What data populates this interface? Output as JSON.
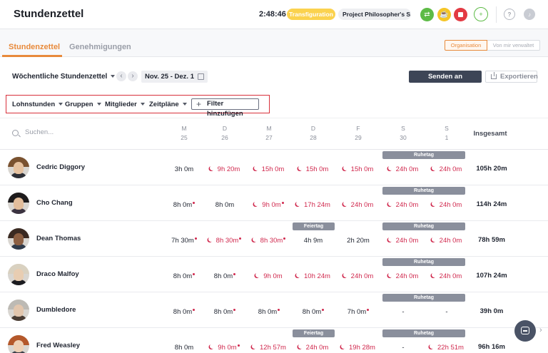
{
  "header": {
    "title": "Stundenzettel",
    "timer": "2:48:46",
    "activity": "Transfiguration",
    "project": "Project Philosopher's S...",
    "icons": [
      "switch-activity-icon",
      "break-icon",
      "stop-icon",
      "add-time-icon",
      "help-icon",
      "notifications-icon"
    ],
    "help_glyph": "?"
  },
  "tabs": [
    {
      "label": "Stundenzettel",
      "active": true
    },
    {
      "label": "Genehmigungen",
      "active": false
    }
  ],
  "scope_toggle": {
    "organisation": "Organisation",
    "managed": "Von mir verwaltet",
    "selected": "Organisation"
  },
  "toolbar": {
    "view_select": "Wöchentliche Stundenzettel",
    "date_range": "Nov. 25 - Dez. 1",
    "qb_button": "Senden an QuickBooks",
    "export_button": "Exportieren"
  },
  "filters": {
    "items": [
      "Lohnstunden",
      "Gruppen",
      "Mitglieder",
      "Zeitpläne"
    ],
    "add_filter": "Filter hinzufügen"
  },
  "search": {
    "placeholder": "Suchen..."
  },
  "columns": {
    "days": [
      {
        "letter": "M",
        "date": "25"
      },
      {
        "letter": "D",
        "date": "26"
      },
      {
        "letter": "M",
        "date": "27"
      },
      {
        "letter": "D",
        "date": "28"
      },
      {
        "letter": "F",
        "date": "29"
      },
      {
        "letter": "S",
        "date": "30"
      },
      {
        "letter": "S",
        "date": "1"
      }
    ],
    "total": "Insgesamt"
  },
  "badges": {
    "rest": "Ruhetag",
    "holiday": "Feiertag"
  },
  "colors": {
    "accent": "#e88a3b",
    "overtime": "#d0284d",
    "primary_button": "#3d4556",
    "highlight_box": "#d8303b"
  },
  "rows": [
    {
      "name": "Cedric Diggory",
      "total": "105h 20m",
      "holiday": false,
      "cells": [
        {
          "v": "3h 0m",
          "ot": false,
          "dot": false
        },
        {
          "v": "9h 20m",
          "ot": true,
          "dot": false
        },
        {
          "v": "15h 0m",
          "ot": true,
          "dot": false
        },
        {
          "v": "15h 0m",
          "ot": true,
          "dot": false
        },
        {
          "v": "15h 0m",
          "ot": true,
          "dot": false
        },
        {
          "v": "24h 0m",
          "ot": true,
          "dot": false
        },
        {
          "v": "24h 0m",
          "ot": true,
          "dot": false
        }
      ]
    },
    {
      "name": "Cho Chang",
      "total": "114h 24m",
      "holiday": false,
      "cells": [
        {
          "v": "8h 0m",
          "ot": false,
          "dot": true
        },
        {
          "v": "8h 0m",
          "ot": false,
          "dot": false
        },
        {
          "v": "9h 0m",
          "ot": true,
          "dot": true
        },
        {
          "v": "17h 24m",
          "ot": true,
          "dot": false
        },
        {
          "v": "24h 0m",
          "ot": true,
          "dot": false
        },
        {
          "v": "24h 0m",
          "ot": true,
          "dot": false
        },
        {
          "v": "24h 0m",
          "ot": true,
          "dot": false
        }
      ]
    },
    {
      "name": "Dean Thomas",
      "total": "78h 59m",
      "holiday": true,
      "cells": [
        {
          "v": "7h 30m",
          "ot": false,
          "dot": true
        },
        {
          "v": "8h 30m",
          "ot": true,
          "dot": true
        },
        {
          "v": "8h 30m",
          "ot": true,
          "dot": true
        },
        {
          "v": "4h 9m",
          "ot": false,
          "dot": false
        },
        {
          "v": "2h 20m",
          "ot": false,
          "dot": false
        },
        {
          "v": "24h 0m",
          "ot": true,
          "dot": false
        },
        {
          "v": "24h 0m",
          "ot": true,
          "dot": false
        }
      ]
    },
    {
      "name": "Draco Malfoy",
      "total": "107h 24m",
      "holiday": false,
      "cells": [
        {
          "v": "8h 0m",
          "ot": false,
          "dot": true
        },
        {
          "v": "8h 0m",
          "ot": false,
          "dot": true
        },
        {
          "v": "9h 0m",
          "ot": true,
          "dot": false
        },
        {
          "v": "10h 24m",
          "ot": true,
          "dot": false
        },
        {
          "v": "24h 0m",
          "ot": true,
          "dot": false
        },
        {
          "v": "24h 0m",
          "ot": true,
          "dot": false
        },
        {
          "v": "24h 0m",
          "ot": true,
          "dot": false
        }
      ]
    },
    {
      "name": "Dumbledore",
      "total": "39h 0m",
      "holiday": false,
      "cells": [
        {
          "v": "8h 0m",
          "ot": false,
          "dot": true
        },
        {
          "v": "8h 0m",
          "ot": false,
          "dot": true
        },
        {
          "v": "8h 0m",
          "ot": false,
          "dot": true
        },
        {
          "v": "8h 0m",
          "ot": false,
          "dot": true
        },
        {
          "v": "7h 0m",
          "ot": false,
          "dot": true
        },
        {
          "v": "-",
          "ot": false,
          "dot": false
        },
        {
          "v": "-",
          "ot": false,
          "dot": false
        }
      ]
    },
    {
      "name": "Fred Weasley",
      "total": "96h 16m",
      "holiday": true,
      "cells": [
        {
          "v": "8h 0m",
          "ot": false,
          "dot": false
        },
        {
          "v": "9h 0m",
          "ot": true,
          "dot": true
        },
        {
          "v": "12h 57m",
          "ot": true,
          "dot": false
        },
        {
          "v": "24h 0m",
          "ot": true,
          "dot": false
        },
        {
          "v": "19h 28m",
          "ot": true,
          "dot": false
        },
        {
          "v": "-",
          "ot": false,
          "dot": false
        },
        {
          "v": "22h 51m",
          "ot": true,
          "dot": false
        }
      ]
    }
  ]
}
